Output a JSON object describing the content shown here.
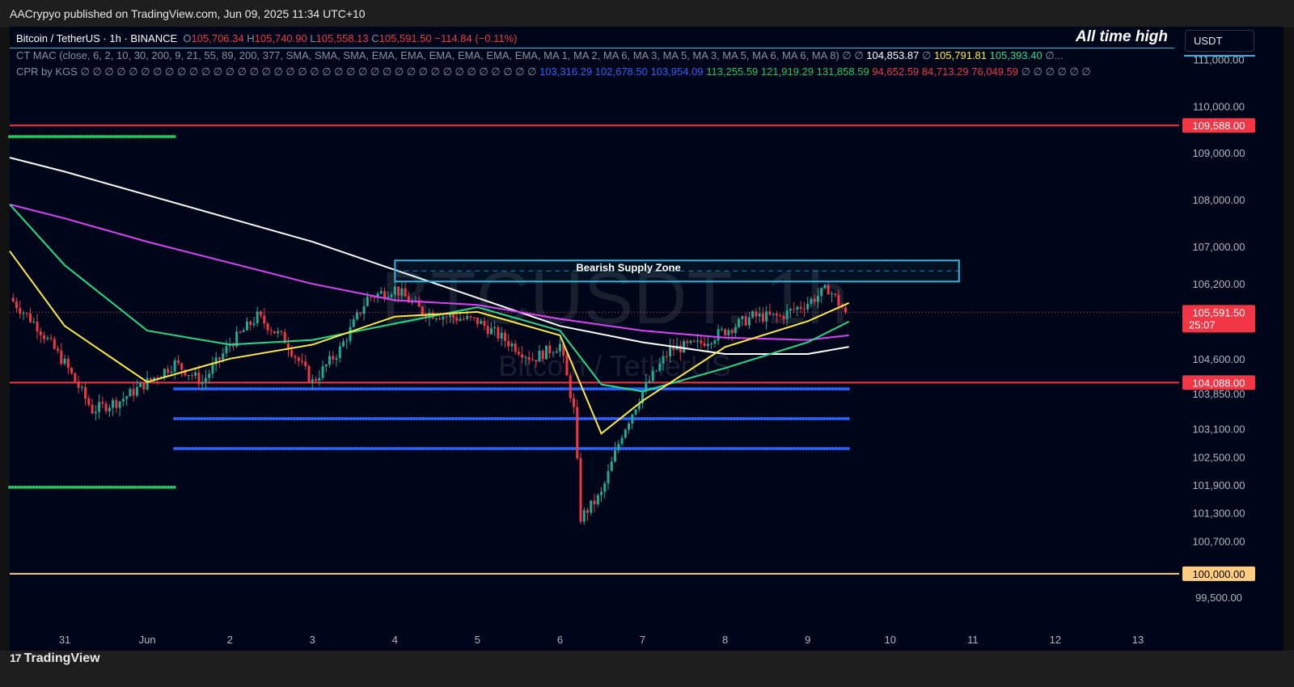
{
  "header": {
    "published_by": "AACrypyo published on TradingView.com, Jun 09, 2025 11:34 UTC+10",
    "all_time_high_label": "All time high",
    "currency": "USDT"
  },
  "symbol_legend": {
    "symbol": "Bitcoin / TetherUS · 1h · BINANCE",
    "open_label": "O",
    "open": "105,706.34",
    "high_label": "H",
    "high": "105,740.90",
    "low_label": "L",
    "low": "105,558.13",
    "close_label": "C",
    "close": "105,591.50",
    "change": "−114.84 (−0.11%)"
  },
  "indicators": [
    {
      "name": "CT MAC (close, 6, 2, 10, 30, 200, 9, 21, 55, 89, 200, 377, SMA, SMA, SMA, EMA, EMA, EMA, EMA, EMA, EMA, MA 1, MA 2, MA 6, MA 3, MA 5, MA 3, MA 5, MA 6, MA 6, MA 8)",
      "prefix_markers": "∅ ∅",
      "values": [
        {
          "text": "104,853.87",
          "color": "#ffffff"
        },
        {
          "text": "∅",
          "color": "#8a8f9e"
        },
        {
          "text": "105,791.81",
          "color": "#ffeb3b"
        },
        {
          "text": "105,393.40",
          "color": "#22dd88"
        },
        {
          "text": "∅...",
          "color": "#8a8f9e"
        }
      ]
    },
    {
      "name": "CPR by KGS",
      "prefix_markers": "∅ ∅ ∅ ∅ ∅ ∅ ∅ ∅ ∅ ∅ ∅ ∅ ∅ ∅ ∅ ∅ ∅ ∅ ∅ ∅ ∅ ∅ ∅ ∅ ∅ ∅ ∅ ∅ ∅ ∅ ∅ ∅ ∅ ∅ ∅ ∅ ∅ ∅",
      "values": [
        {
          "text": "103,316.29",
          "color": "#2962ff"
        },
        {
          "text": "102,678.50",
          "color": "#2962ff"
        },
        {
          "text": "103,954.09",
          "color": "#2962ff"
        },
        {
          "text": "113,255.59",
          "color": "#22c55e"
        },
        {
          "text": "121,919.29",
          "color": "#22c55e"
        },
        {
          "text": "131,858.59",
          "color": "#22c55e"
        },
        {
          "text": "94,652.59",
          "color": "#f23645"
        },
        {
          "text": "84,713.29",
          "color": "#f23645"
        },
        {
          "text": "76,049.59",
          "color": "#f23645"
        },
        {
          "text": "∅ ∅ ∅ ∅ ∅ ∅",
          "color": "#8a8f9e"
        }
      ]
    }
  ],
  "watermark": {
    "symbol": "BTCUSDT, 1h",
    "name": "Bitcoin / TetherUS"
  },
  "zone_label": "Bearish Supply Zone",
  "countdown": "25:07",
  "footer": {
    "logo": "TradingView",
    "logo_mark": "17"
  },
  "colors": {
    "background": "#000619",
    "bull": "#22ab94",
    "bear": "#f23645",
    "resistance": "#f23645",
    "psychological": "#ffcc80",
    "cpr_pivot": "#2962ff",
    "cpr_outer": "#22c55e",
    "ema_fast": "#ffeb3b",
    "ema_mid": "#22dd88",
    "ema_slow": "#e040fb",
    "ma_long": "#ffffff",
    "zone": "#2ab7e0"
  },
  "chart_data": {
    "type": "candlestick",
    "x_axis": {
      "type": "time",
      "range": [
        "2025-05-30T08:00",
        "2025-06-13T12:00"
      ],
      "tick_labels": [
        "31",
        "Jun",
        "2",
        "3",
        "4",
        "5",
        "6",
        "7",
        "8",
        "9",
        "10",
        "11",
        "12",
        "13"
      ],
      "tick_dates": [
        "2025-05-31",
        "2025-06-01",
        "2025-06-02",
        "2025-06-03",
        "2025-06-04",
        "2025-06-05",
        "2025-06-06",
        "2025-06-07",
        "2025-06-08",
        "2025-06-09",
        "2025-06-10",
        "2025-06-11",
        "2025-06-12",
        "2025-06-13"
      ]
    },
    "y_axis": {
      "range": [
        99100,
        111700
      ],
      "tick_labels": [
        "111,000.00",
        "110,000.00",
        "109,000.00",
        "108,000.00",
        "107,000.00",
        "106,200.00",
        "104,600.00",
        "103,850.00",
        "103,100.00",
        "102,500.00",
        "101,900.00",
        "101,300.00",
        "100,700.00",
        "99,500.00"
      ],
      "tick_values": [
        111000,
        110000,
        109000,
        108000,
        107000,
        106200,
        104600,
        103850,
        103100,
        102500,
        101900,
        101300,
        100700,
        99500
      ]
    },
    "close_path": [
      [
        "2025-05-30T08:00",
        105900
      ],
      [
        "2025-05-30T16:00",
        105300
      ],
      [
        "2025-05-31T00:00",
        104500
      ],
      [
        "2025-05-31T08:00",
        103500
      ],
      [
        "2025-05-31T16:00",
        103700
      ],
      [
        "2025-06-01T00:00",
        104100
      ],
      [
        "2025-06-01T08:00",
        104500
      ],
      [
        "2025-06-01T16:00",
        104100
      ],
      [
        "2025-06-02T00:00",
        104900
      ],
      [
        "2025-06-02T08:00",
        105500
      ],
      [
        "2025-06-02T16:00",
        105000
      ],
      [
        "2025-06-03T00:00",
        104100
      ],
      [
        "2025-06-03T08:00",
        104800
      ],
      [
        "2025-06-03T16:00",
        105900
      ],
      [
        "2025-06-04T00:00",
        106100
      ],
      [
        "2025-06-04T08:00",
        105600
      ],
      [
        "2025-06-04T16:00",
        105500
      ],
      [
        "2025-06-05T00:00",
        105400
      ],
      [
        "2025-06-05T08:00",
        105000
      ],
      [
        "2025-06-05T16:00",
        104600
      ],
      [
        "2025-06-06T00:00",
        104900
      ],
      [
        "2025-06-06T04:00",
        103500
      ],
      [
        "2025-06-06T06:00",
        101200
      ],
      [
        "2025-06-06T12:00",
        101700
      ],
      [
        "2025-06-06T18:00",
        103000
      ],
      [
        "2025-06-07T00:00",
        103900
      ],
      [
        "2025-06-07T08:00",
        104800
      ],
      [
        "2025-06-07T16:00",
        104900
      ],
      [
        "2025-06-08T00:00",
        105200
      ],
      [
        "2025-06-08T08:00",
        105500
      ],
      [
        "2025-06-08T16:00",
        105500
      ],
      [
        "2025-06-09T00:00",
        105800
      ],
      [
        "2025-06-09T06:00",
        106100
      ],
      [
        "2025-06-09T11:00",
        105591.5
      ]
    ],
    "wick_extremes": {
      "high": 106250,
      "low": 100400
    },
    "last_price": 105591.5,
    "levels": [
      {
        "value": 109588,
        "label": "109,588.00",
        "color": "#f23645"
      },
      {
        "value": 104088,
        "label": "104,088.00",
        "color": "#f23645"
      },
      {
        "value": 100000,
        "label": "100,000.00",
        "color": "#ffcc80"
      }
    ],
    "cpr_levels": [
      {
        "value": 109350,
        "from": "2025-05-30T08:00",
        "to": "2025-06-01T08:00",
        "color": "#22c55e"
      },
      {
        "value": 101850,
        "from": "2025-05-30T08:00",
        "to": "2025-06-01T08:00",
        "color": "#22c55e"
      },
      {
        "value": 103954.09,
        "from": "2025-06-01T08:00",
        "to": "2025-06-09T12:00",
        "color": "#2962ff"
      },
      {
        "value": 103316.29,
        "from": "2025-06-01T08:00",
        "to": "2025-06-09T12:00",
        "color": "#2962ff"
      },
      {
        "value": 102678.5,
        "from": "2025-06-01T08:00",
        "to": "2025-06-09T12:00",
        "color": "#2962ff"
      }
    ],
    "supply_zone": {
      "from": "2025-06-04T00:00",
      "to": "2025-06-10T20:00",
      "top": 106700,
      "bottom": 106250
    },
    "series": [
      {
        "color": "#ffffff",
        "points": [
          [
            "2025-05-30T08:00",
            108900
          ],
          [
            "2025-05-31T00:00",
            108600
          ],
          [
            "2025-06-01T00:00",
            108100
          ],
          [
            "2025-06-02T00:00",
            107600
          ],
          [
            "2025-06-03T00:00",
            107100
          ],
          [
            "2025-06-04T00:00",
            106500
          ],
          [
            "2025-06-05T00:00",
            105900
          ],
          [
            "2025-06-06T00:00",
            105300
          ],
          [
            "2025-06-07T00:00",
            104950
          ],
          [
            "2025-06-08T00:00",
            104700
          ],
          [
            "2025-06-09T00:00",
            104700
          ],
          [
            "2025-06-09T12:00",
            104853.87
          ]
        ]
      },
      {
        "color": "#e040fb",
        "points": [
          [
            "2025-05-30T08:00",
            107900
          ],
          [
            "2025-05-31T00:00",
            107600
          ],
          [
            "2025-06-01T00:00",
            107100
          ],
          [
            "2025-06-02T00:00",
            106650
          ],
          [
            "2025-06-03T00:00",
            106200
          ],
          [
            "2025-06-04T00:00",
            105850
          ],
          [
            "2025-06-05T00:00",
            105750
          ],
          [
            "2025-06-06T00:00",
            105450
          ],
          [
            "2025-06-07T00:00",
            105200
          ],
          [
            "2025-06-08T00:00",
            105050
          ],
          [
            "2025-06-09T00:00",
            105000
          ],
          [
            "2025-06-09T12:00",
            105100
          ]
        ]
      },
      {
        "color": "#22dd88",
        "points": [
          [
            "2025-05-30T08:00",
            107900
          ],
          [
            "2025-05-31T00:00",
            106600
          ],
          [
            "2025-06-01T00:00",
            105200
          ],
          [
            "2025-06-02T00:00",
            104900
          ],
          [
            "2025-06-03T00:00",
            105000
          ],
          [
            "2025-06-04T00:00",
            105350
          ],
          [
            "2025-06-05T00:00",
            105700
          ],
          [
            "2025-06-06T00:00",
            105200
          ],
          [
            "2025-06-06T12:00",
            104050
          ],
          [
            "2025-06-07T00:00",
            103900
          ],
          [
            "2025-06-08T00:00",
            104400
          ],
          [
            "2025-06-09T00:00",
            104950
          ],
          [
            "2025-06-09T12:00",
            105393.4
          ]
        ]
      },
      {
        "color": "#ffeb3b",
        "points": [
          [
            "2025-05-30T08:00",
            106900
          ],
          [
            "2025-05-31T00:00",
            105300
          ],
          [
            "2025-06-01T00:00",
            104100
          ],
          [
            "2025-06-02T00:00",
            104600
          ],
          [
            "2025-06-03T00:00",
            104900
          ],
          [
            "2025-06-04T00:00",
            105500
          ],
          [
            "2025-06-05T00:00",
            105600
          ],
          [
            "2025-06-06T00:00",
            105100
          ],
          [
            "2025-06-06T12:00",
            103000
          ],
          [
            "2025-06-07T00:00",
            103700
          ],
          [
            "2025-06-08T00:00",
            104850
          ],
          [
            "2025-06-09T00:00",
            105400
          ],
          [
            "2025-06-09T12:00",
            105791.81
          ]
        ]
      }
    ]
  }
}
